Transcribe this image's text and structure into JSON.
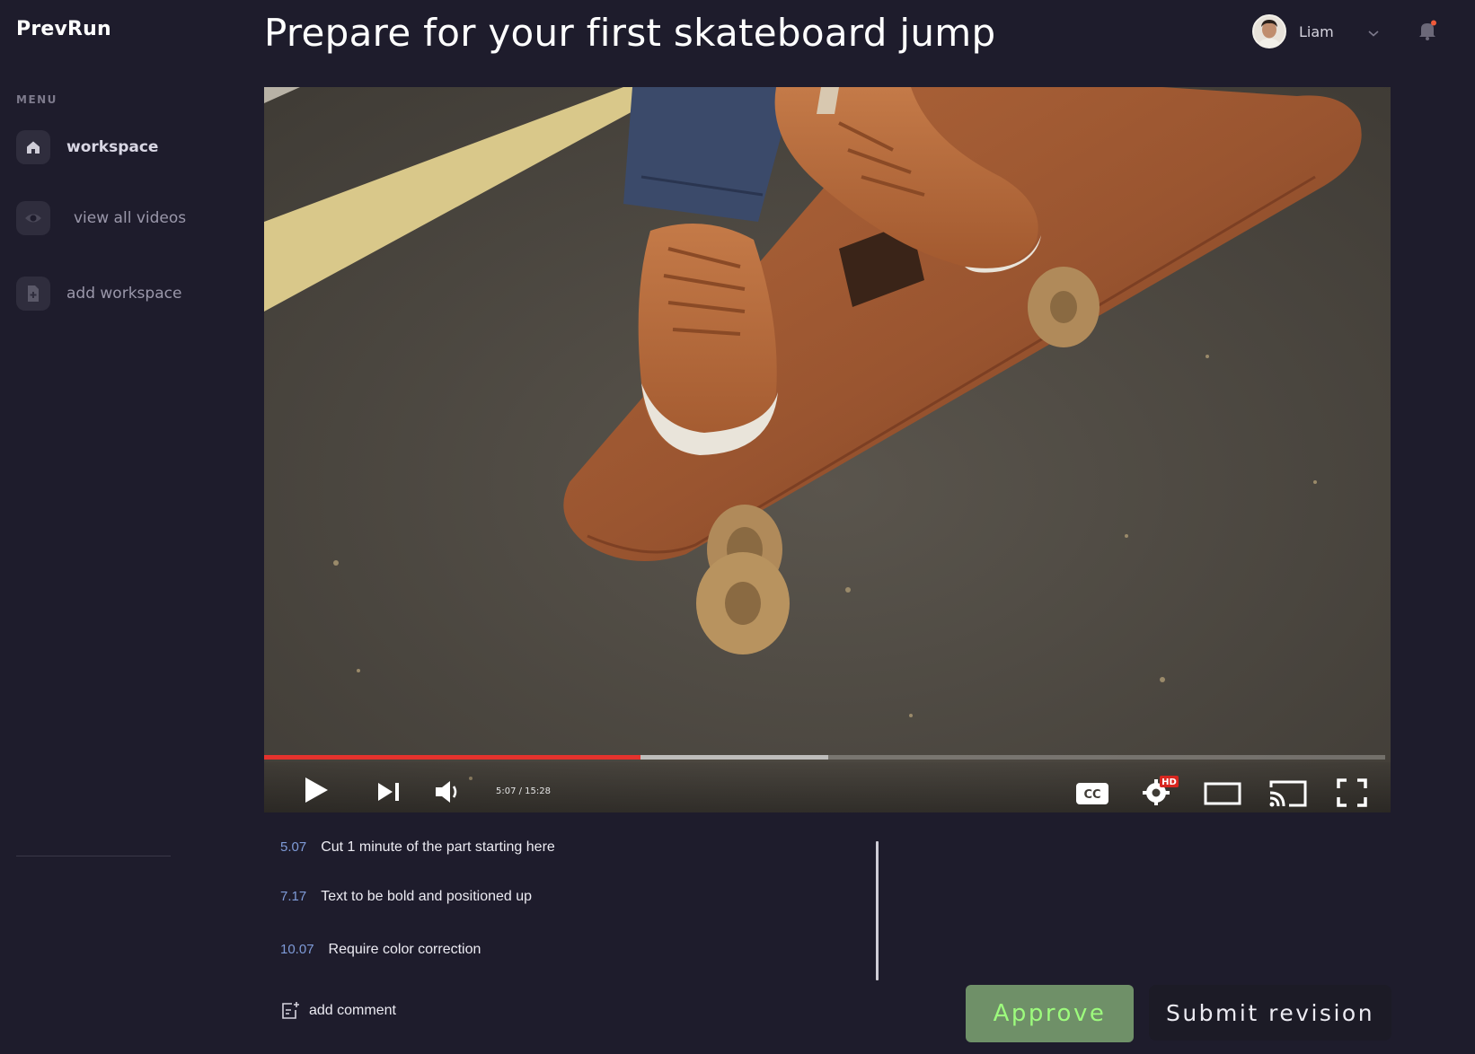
{
  "app": {
    "brand": "PrevRun"
  },
  "sidebar": {
    "menu_label": "MENU",
    "items": [
      {
        "label": "workspace",
        "icon": "home-icon"
      },
      {
        "label": "view all videos",
        "icon": "eye-icon"
      },
      {
        "label": "add workspace",
        "icon": "add-file-icon"
      }
    ]
  },
  "header": {
    "title": "Prepare for your first skateboard jump",
    "user_name": "Liam"
  },
  "player": {
    "time_display": "5:07 / 15:28",
    "progress_fraction": 0.336,
    "buffered_fraction": 0.503,
    "hd_badge": "HD",
    "cc_label": "CC",
    "accent_color": "#e5322d"
  },
  "comments": [
    {
      "time": "5.07",
      "text": "Cut 1 minute of the part starting here"
    },
    {
      "time": "7.17",
      "text": "Text to be bold and positioned up"
    },
    {
      "time": "10.07",
      "text": "Require color correction"
    }
  ],
  "add_comment_label": "add comment",
  "actions": {
    "approve_label": "Approve",
    "submit_label": "Submit revision"
  }
}
